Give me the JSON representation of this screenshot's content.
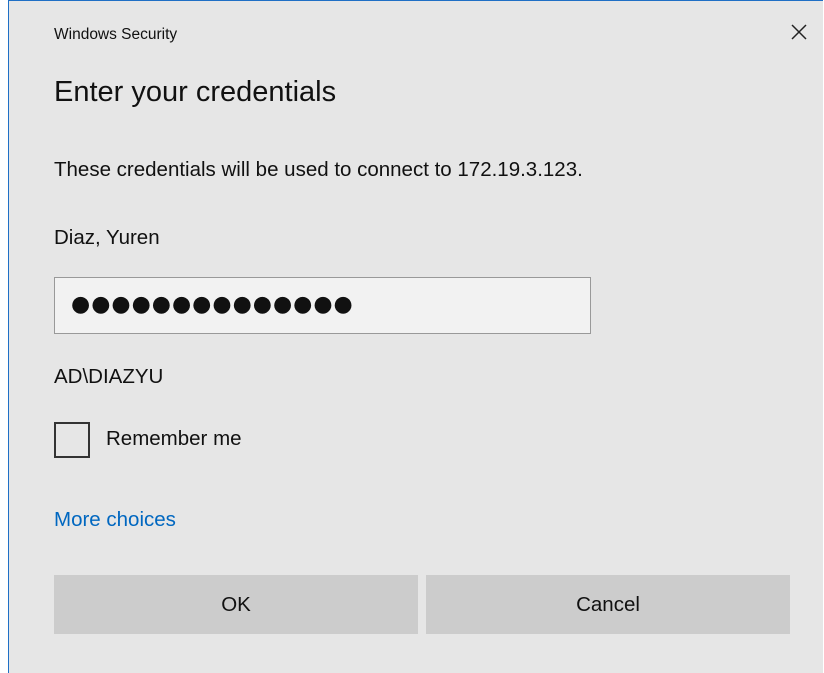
{
  "window": {
    "app_title": "Windows Security",
    "close_icon": "close-icon"
  },
  "dialog": {
    "heading": "Enter your credentials",
    "description": "These credentials will be used to connect to 172.19.3.123.",
    "username": "Diaz, Yuren",
    "password": {
      "value_masked": "●●●●●●●●●●●●●●",
      "type": "password"
    },
    "domain_account": "AD\\DIAZYU",
    "remember_me": {
      "label": "Remember me",
      "checked": false
    },
    "more_choices_link": "More choices",
    "buttons": {
      "ok_label": "OK",
      "cancel_label": "Cancel"
    }
  },
  "colors": {
    "dialog_background": "#e6e6e6",
    "button_background": "#cccccc",
    "link_color": "#0067c0",
    "border_accent": "#1f6fc5"
  }
}
